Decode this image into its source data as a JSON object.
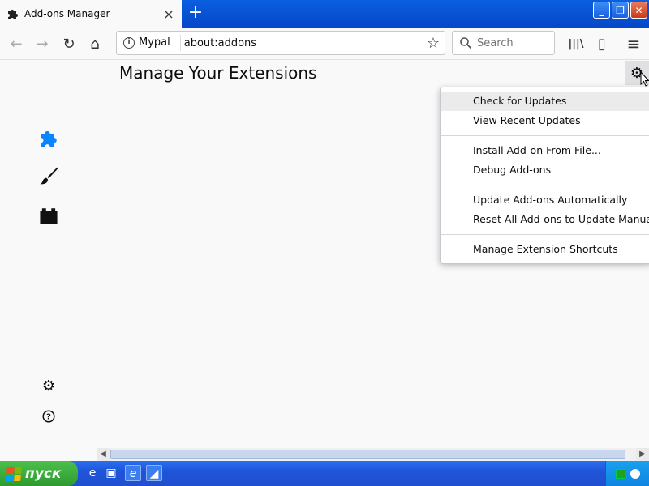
{
  "tab": {
    "title": "Add-ons Manager",
    "close": "×",
    "favicon": "puzzle-icon"
  },
  "window": {
    "new_tab": "+",
    "minimize": "_",
    "maximize": "❐",
    "close": "✕"
  },
  "nav": {
    "back": "←",
    "forward": "→",
    "reload": "↻",
    "home": "⌂",
    "identity": "Mypal",
    "url": "about:addons",
    "search_placeholder": "Search",
    "library": "|||\\",
    "sidebar": "▯",
    "menu": "≡"
  },
  "page": {
    "title": "Manage Your Extensions"
  },
  "sidebar": {
    "items": [
      {
        "name": "extensions",
        "icon": "puzzle-icon",
        "color": "#0a84ff"
      },
      {
        "name": "themes",
        "icon": "brush-icon"
      },
      {
        "name": "plugins",
        "icon": "plugin-icon"
      }
    ],
    "bottom": [
      {
        "name": "addon-options",
        "icon": "gear-icon"
      },
      {
        "name": "addon-support",
        "icon": "help-icon"
      }
    ]
  },
  "tools_menu": {
    "items": [
      {
        "label": "Check for Updates",
        "highlighted": true
      },
      {
        "label": "View Recent Updates"
      },
      {
        "separator": true
      },
      {
        "label": "Install Add-on From File..."
      },
      {
        "label": "Debug Add-ons"
      },
      {
        "separator": true
      },
      {
        "label": "Update Add-ons Automatically"
      },
      {
        "label": "Reset All Add-ons to Update Manually"
      },
      {
        "separator": true
      },
      {
        "label": "Manage Extension Shortcuts"
      }
    ]
  },
  "taskbar": {
    "start_label": "пуск"
  },
  "colors": {
    "accent": "#0a84ff",
    "titlebar": "#0a5fe0",
    "taskbar": "#2a6ef0",
    "start": "#3aa83a"
  }
}
